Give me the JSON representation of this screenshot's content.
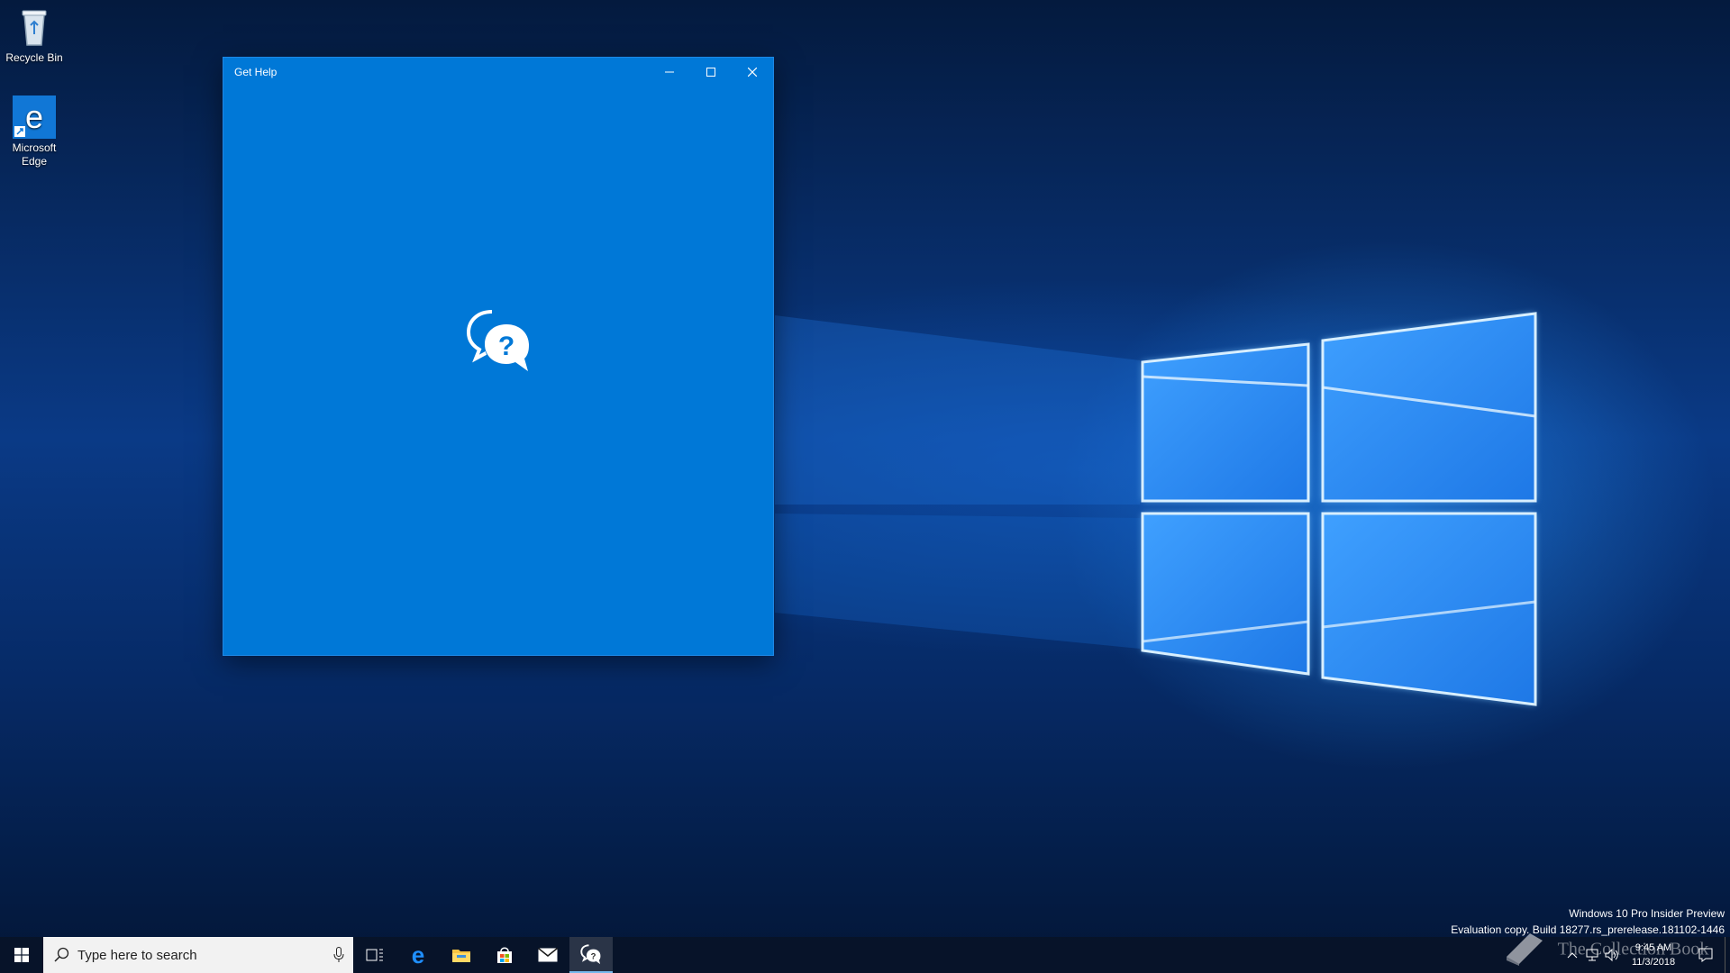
{
  "desktop": {
    "icons": [
      {
        "label": "Recycle Bin",
        "icon": "recycle-bin-icon"
      },
      {
        "label": "Microsoft Edge",
        "icon": "edge-icon"
      }
    ],
    "watermark": {
      "line1": "Windows 10 Pro Insider Preview",
      "line2": "Evaluation copy. Build 18277.rs_prerelease.181102-1446"
    },
    "collection_watermark": "The Collection Book"
  },
  "window": {
    "title": "Get Help",
    "controls": [
      "minimize-icon",
      "maximize-icon",
      "close-icon"
    ],
    "background": "#0078d7",
    "splash_icon": "help-chat-icon"
  },
  "taskbar": {
    "search": {
      "placeholder": "Type here to search"
    },
    "pinned": [
      "task-view-icon",
      "edge-icon",
      "file-explorer-icon",
      "store-icon",
      "mail-icon",
      "get-help-icon"
    ],
    "active_app": "Get Help",
    "clock": {
      "time": "9:45 AM",
      "date": "11/3/2018"
    }
  }
}
